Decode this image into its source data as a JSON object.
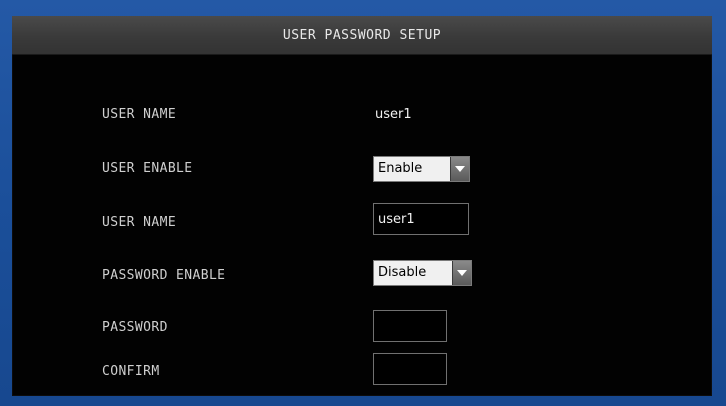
{
  "window": {
    "title": "USER PASSWORD SETUP"
  },
  "form": {
    "rows": {
      "user_name_display": {
        "label": "USER NAME",
        "value": "user1"
      },
      "user_enable": {
        "label": "USER ENABLE",
        "selected": "Enable"
      },
      "user_name_edit": {
        "label": "USER NAME",
        "value": "user1"
      },
      "password_enable": {
        "label": "PASSWORD ENABLE",
        "selected": "Disable"
      },
      "password": {
        "label": "PASSWORD",
        "value": ""
      },
      "confirm": {
        "label": "CONFIRM",
        "value": ""
      }
    }
  },
  "colors": {
    "frame": "#1b4f9a",
    "panel": "#020202",
    "titlebar": "#3a3a3a",
    "text": "#cfcfcf"
  },
  "icons": {
    "dropdown": "chevron-down-icon"
  }
}
